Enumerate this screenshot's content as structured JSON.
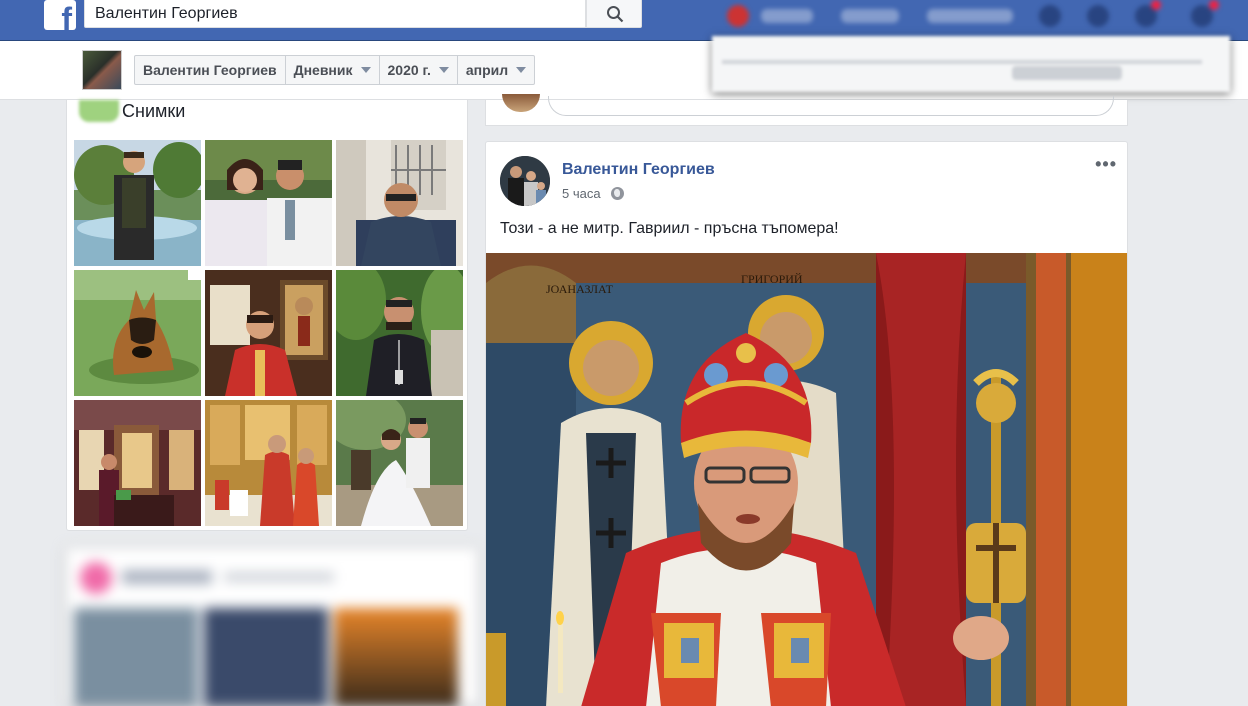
{
  "topbar": {
    "search_value": "Валентин Георгиев",
    "brand_color": "#4267b2"
  },
  "subheader": {
    "crumbs": [
      {
        "label": "Валентин Георгиев"
      },
      {
        "label": "Дневник"
      },
      {
        "label": "2020 г."
      },
      {
        "label": "април"
      }
    ]
  },
  "photos": {
    "title": "Снимки",
    "items": [
      {
        "icon": "photo-priest-by-fountain"
      },
      {
        "icon": "photo-wedding-couple"
      },
      {
        "icon": "photo-man-by-building"
      },
      {
        "icon": "photo-german-shepherd"
      },
      {
        "icon": "photo-priest-in-red-vestments"
      },
      {
        "icon": "photo-priest-in-black-cassock"
      },
      {
        "icon": "photo-church-interior"
      },
      {
        "icon": "photo-clergy-at-altar"
      },
      {
        "icon": "photo-wedding-couple-bench"
      }
    ]
  },
  "post": {
    "author": "Валентин Георгиев",
    "time": "5 часа",
    "text": "Този - а не митр. Гавриил - пръсна тъпомера!",
    "more": "•••"
  }
}
